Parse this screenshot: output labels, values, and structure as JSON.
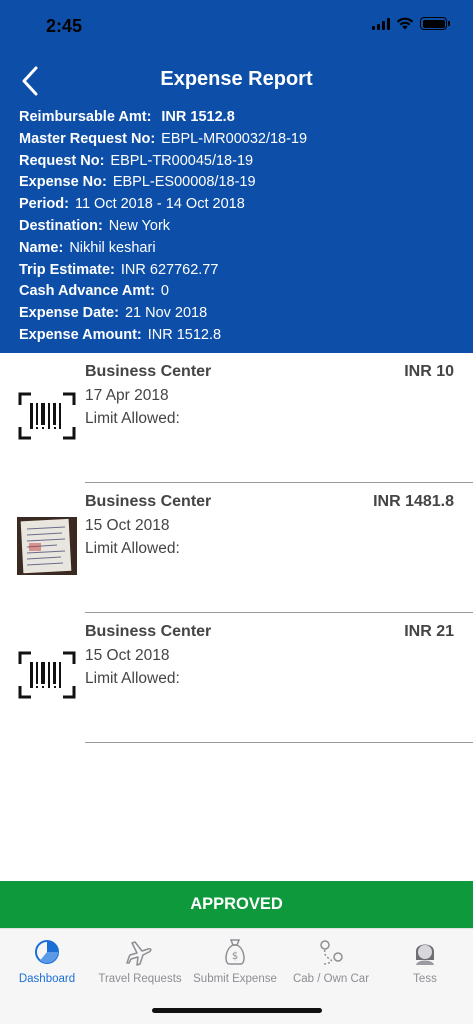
{
  "status_bar": {
    "time": "2:45"
  },
  "header": {
    "title": "Expense Report",
    "details": [
      {
        "label": "Reimbursable Amt:",
        "value": "INR 1512.8",
        "bold_value": true
      },
      {
        "label": "Master Request No:",
        "value": "EBPL-MR00032/18-19"
      },
      {
        "label": "Request No:",
        "value": "EBPL-TR00045/18-19"
      },
      {
        "label": "Expense No:",
        "value": "EBPL-ES00008/18-19"
      },
      {
        "label": "Period:",
        "value": "11 Oct 2018 - 14 Oct 2018"
      },
      {
        "label": "Destination:",
        "value": "New York"
      },
      {
        "label": "Name:",
        "value": "Nikhil keshari"
      },
      {
        "label": "Trip Estimate:",
        "value": "INR 627762.77"
      },
      {
        "label": "Cash Advance Amt:",
        "value": "0"
      },
      {
        "label": "Expense Date:",
        "value": "21 Nov 2018"
      },
      {
        "label": "Expense Amount:",
        "value": "INR 1512.8"
      }
    ]
  },
  "expenses": [
    {
      "name": "Business Center",
      "amount": "INR 10",
      "date": "17 Apr 2018",
      "limit_label": "Limit Allowed:",
      "thumb": "barcode-icon"
    },
    {
      "name": "Business Center",
      "amount": "INR 1481.8",
      "date": "15 Oct 2018",
      "limit_label": "Limit Allowed:",
      "thumb": "receipt-photo"
    },
    {
      "name": "Business Center",
      "amount": "INR 21",
      "date": "15 Oct 2018",
      "limit_label": "Limit Allowed:",
      "thumb": "barcode-icon"
    }
  ],
  "status_button": {
    "label": "APPROVED",
    "color": "#0e9a3c"
  },
  "tabs": [
    {
      "label": "Dashboard",
      "icon": "dashboard-pie-icon",
      "active": true
    },
    {
      "label": "Travel Requests",
      "icon": "airplane-icon",
      "active": false
    },
    {
      "label": "Submit Expense",
      "icon": "money-bag-icon",
      "active": false
    },
    {
      "label": "Cab / Own Car",
      "icon": "route-pin-icon",
      "active": false
    },
    {
      "label": "Tess",
      "icon": "avatar-icon",
      "active": false
    }
  ],
  "colors": {
    "header_bg": "#0d4fa8",
    "accent": "#1a6fd6",
    "approved": "#0e9a3c"
  }
}
